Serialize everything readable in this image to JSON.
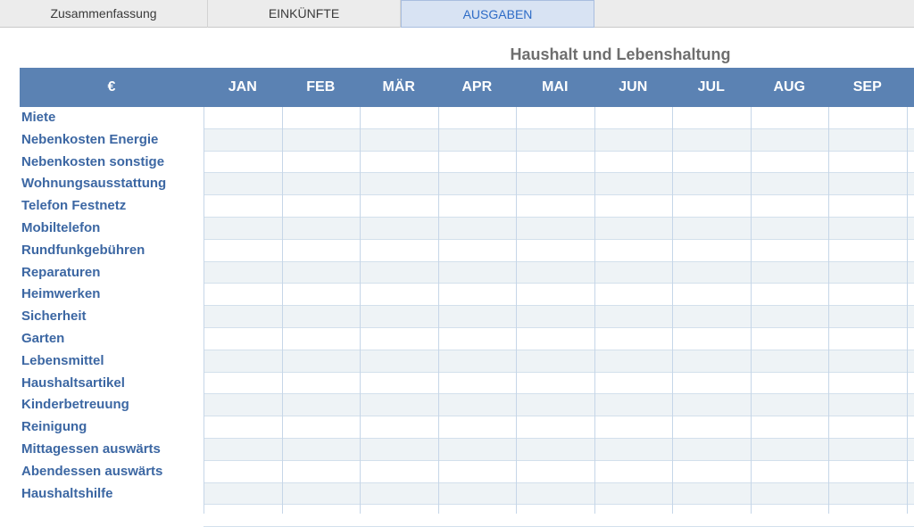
{
  "tabs": [
    {
      "label": "Zusammenfassung",
      "active": false
    },
    {
      "label": "EINKÜNFTE",
      "active": false
    },
    {
      "label": "AUSGABEN",
      "active": true
    }
  ],
  "sheet": {
    "title": "Haushalt und Lebenshaltung",
    "currency_header": "€",
    "months": [
      "JAN",
      "FEB",
      "MÄR",
      "APR",
      "MAI",
      "JUN",
      "JUL",
      "AUG",
      "SEP"
    ],
    "rows": [
      "Miete",
      "Nebenkosten Energie",
      "Nebenkosten sonstige",
      "Wohnungsausstattung",
      "Telefon Festnetz",
      "Mobiltelefon",
      "Rundfunkgebühren",
      "Reparaturen",
      "Heimwerken",
      "Sicherheit",
      "Garten",
      "Lebensmittel",
      "Haushaltsartikel",
      "Kinderbetreuung",
      "Reinigung",
      "Mittagessen auswärts",
      "Abendessen auswärts",
      "Haushaltshilfe"
    ]
  },
  "colors": {
    "header_bg": "#5b82b3",
    "label_text": "#3c67a3",
    "active_tab_text": "#2d6bc6",
    "stripe": "#eef3f6"
  }
}
